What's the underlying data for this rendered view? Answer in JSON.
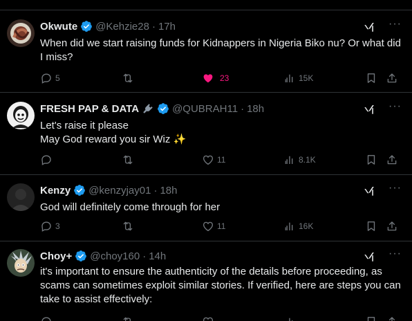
{
  "tweets": [
    {
      "name": "Okwute",
      "handle": "@Kehzie28",
      "time": "17h",
      "text": "When did we start raising funds for Kidnappers in Nigeria Biko nu?  Or what did I miss?",
      "replies": "5",
      "retweets": "",
      "likes": "23",
      "liked": true,
      "views": "15K"
    },
    {
      "name": "FRESH PAP & DATA",
      "handle": "@QUBRAH11",
      "time": "18h",
      "text_line1": "Let's raise it please",
      "text_line2": "May God reward you sir Wiz",
      "emoji": "✨",
      "replies": "",
      "retweets": "",
      "likes": "11",
      "views": "8.1K"
    },
    {
      "name": "Kenzy",
      "handle": "@kenzyjay01",
      "time": "18h",
      "text": "God will definitely come through for her",
      "replies": "3",
      "retweets": "",
      "likes": "11",
      "views": "16K"
    },
    {
      "name": "Choy+",
      "handle": "@choy160",
      "time": "14h",
      "text": "it's important to ensure the authenticity of the details before proceeding, as scams can sometimes exploit similar stories. If verified, here are steps you can take to assist effectively:"
    }
  ],
  "dot": "·",
  "colors": {
    "background": "#000000",
    "text": "#e7e9ea",
    "muted": "#71767b",
    "verified": "#1d9bf0",
    "like": "#f91880",
    "border": "#2f3336"
  },
  "icons": [
    "verified-icon",
    "grok-icon",
    "more-icon",
    "reply-icon",
    "retweet-icon",
    "heart-icon",
    "views-icon",
    "bookmark-icon",
    "share-icon",
    "plug-icon"
  ]
}
